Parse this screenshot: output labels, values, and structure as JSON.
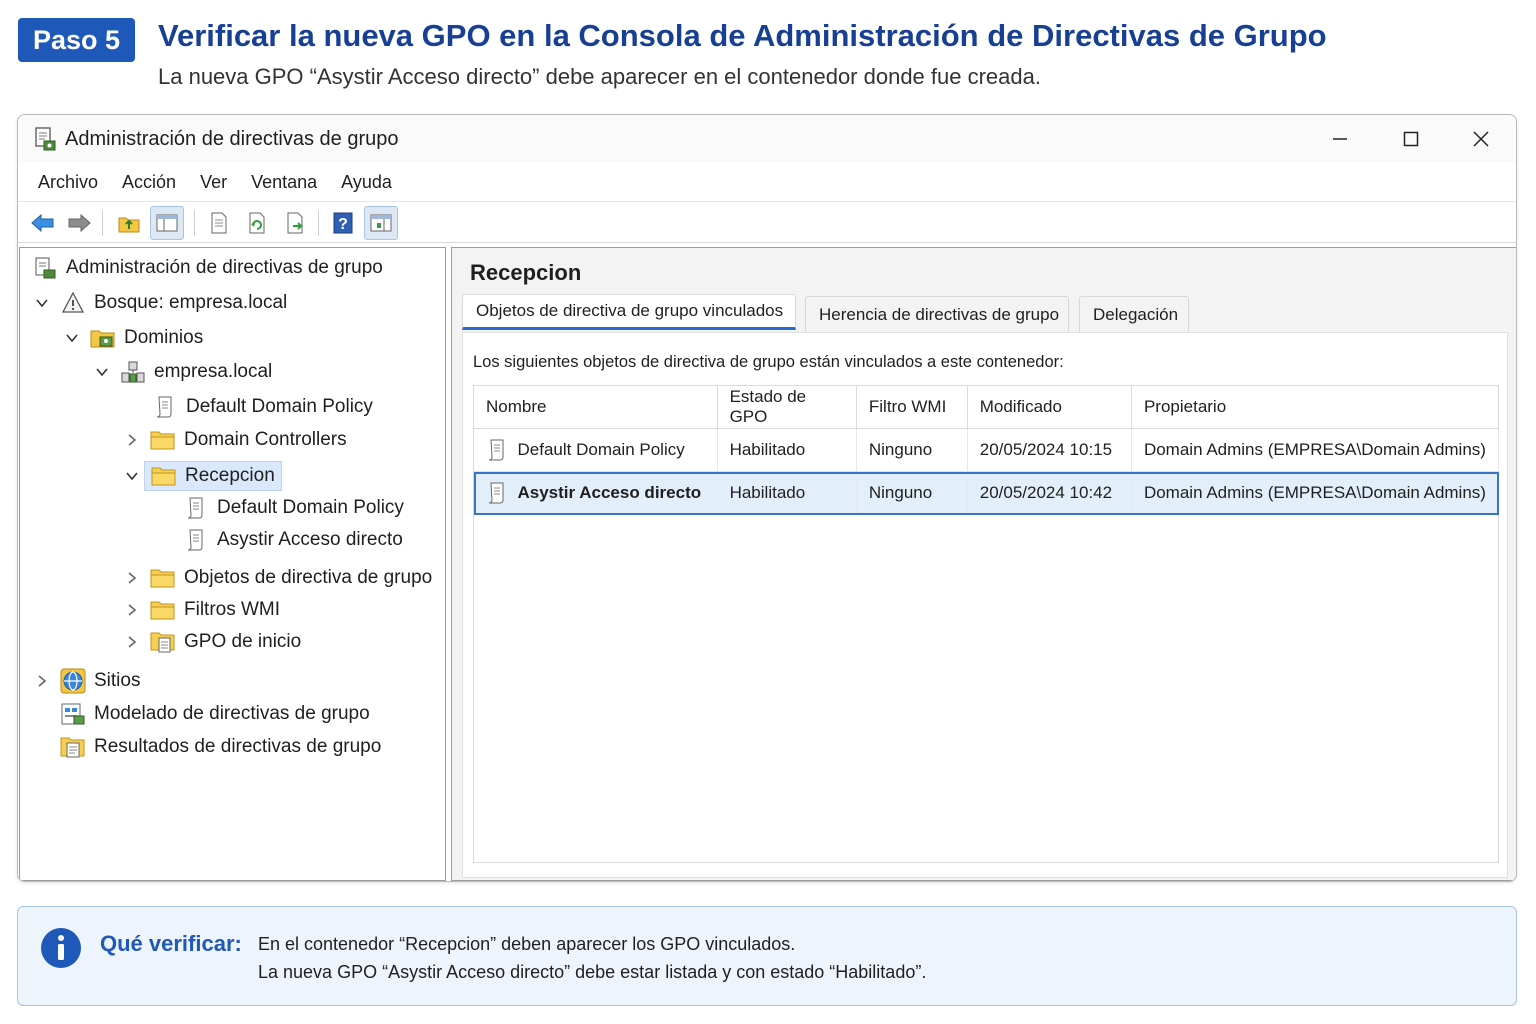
{
  "header": {
    "step_label": "Paso 5",
    "title": "Verificar la nueva GPO en la Consola de Administración de Directivas de Grupo",
    "subtitle": "La nueva GPO “Asystir Acceso directo” debe aparecer en el contenedor donde fue creada."
  },
  "window": {
    "title": "Administración de directivas de grupo",
    "menu": [
      "Archivo",
      "Acción",
      "Ver",
      "Ventana",
      "Ayuda"
    ],
    "toolbar_icons": [
      "back-arrow-icon",
      "forward-arrow-icon",
      "up-folder-icon",
      "show-hide-tree-icon",
      "properties-icon",
      "refresh-icon",
      "export-list-icon",
      "help-icon",
      "show-action-pane-icon"
    ]
  },
  "tree": {
    "root": "Administración de directivas de grupo",
    "forest": "Bosque: empresa.local",
    "domains": "Dominios",
    "domain": "empresa.local",
    "default_domain_policy": "Default Domain Policy",
    "domain_controllers": "Domain Controllers",
    "recepcion": "Recepcion",
    "recepcion_child_1": "Default Domain Policy",
    "recepcion_child_2": "Asystir Acceso directo",
    "gpo_objects": "Objetos de directiva de grupo",
    "wmi_filters": "Filtros WMI",
    "starter_gpos": "GPO de inicio",
    "sites": "Sitios",
    "modeling": "Modelado de directivas de grupo",
    "results": "Resultados de directivas de grupo"
  },
  "details": {
    "title": "Recepcion",
    "tabs": [
      "Objetos de directiva de grupo vinculados",
      "Herencia de directivas de grupo",
      "Delegación"
    ],
    "description": "Los siguientes objetos de directiva de grupo están vinculados a este contenedor:",
    "columns": [
      "Nombre",
      "Estado de GPO",
      "Filtro WMI",
      "Modificado",
      "Propietario"
    ],
    "rows": [
      {
        "name": "Default Domain Policy",
        "status": "Habilitado",
        "wmi": "Ninguno",
        "modified": "20/05/2024 10:15",
        "owner": "Domain Admins (EMPRESA\\Domain Admins)"
      },
      {
        "name": "Asystir Acceso directo",
        "status": "Habilitado",
        "wmi": "Ninguno",
        "modified": "20/05/2024 10:42",
        "owner": "Domain Admins (EMPRESA\\Domain Admins)"
      }
    ]
  },
  "info": {
    "label": "Qué verificar:",
    "line1": "En el contenedor “Recepcion” deben aparecer los GPO vinculados.",
    "line2": "La nueva GPO “Asystir Acceso directo” debe estar listada y con estado “Habilitado”."
  },
  "colors": {
    "accent": "#1e58b8",
    "title": "#173f93",
    "selection": "#e3eefb",
    "info_bg": "#eef4fc"
  }
}
